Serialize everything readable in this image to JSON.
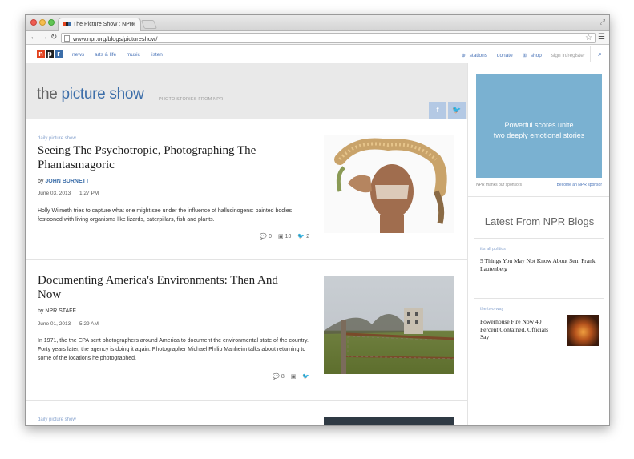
{
  "browser": {
    "tab_title": "The Picture Show : NPR",
    "url": "www.npr.org/blogs/pictureshow/"
  },
  "npr_nav": {
    "logo_letters": [
      "n",
      "p",
      "r"
    ],
    "logo_colors": [
      "#e2421e",
      "#222222",
      "#3c6ea9"
    ],
    "links": [
      "news",
      "arts & life",
      "music",
      "listen"
    ],
    "stations": "stations",
    "donate": "donate",
    "shop": "shop",
    "sign_in": "sign in/register"
  },
  "hero": {
    "title_prefix": "the",
    "title_main": "picture show",
    "subtitle": "PHOTO STORIES FROM NPR",
    "facebook": "f",
    "twitter": "t"
  },
  "stories": [
    {
      "kicker": "daily picture show",
      "headline": "Seeing The Psychotropic, Photographing The Phantasmagoric",
      "by": "by",
      "author": "JOHN BURNETT",
      "date": "June 03, 2013",
      "time": "1:27 PM",
      "teaser": "Holly Wilmeth tries to capture what one might see under the influence of hallucinogens: painted bodies festooned with living organisms like lizards, caterpillars, fish and plants.",
      "comments": "0",
      "facebook_count": "10",
      "twitter_count": "2"
    },
    {
      "kicker": "",
      "headline": "Documenting America's Environments: Then And Now",
      "by": "by",
      "author": "NPR STAFF",
      "date": "June 01, 2013",
      "time": "5:29 AM",
      "teaser": "In 1971, the the EPA sent photographers around America to document the environmental state of the country. Forty years later, the agency is doing it again. Photographer Michael Philip Manheim talks about returning to some of the locations he photographed.",
      "comments": "8",
      "facebook_count": "",
      "twitter_count": ""
    },
    {
      "kicker": "daily picture show"
    }
  ],
  "sidebar": {
    "ad_text_1": "Powerful scores unite",
    "ad_text_2": "two deeply emotional stories",
    "ad_note_left": "NPR thanks our sponsors",
    "ad_note_right": "Become an NPR sponsor",
    "latest_heading": "Latest From NPR Blogs",
    "posts": [
      {
        "kicker": "it's all politics",
        "headline": "5 Things You May Not Know About Sen. Frank Lautenberg"
      },
      {
        "kicker": "the two-way",
        "headline": "Powerhouse Fire Now 40 Percent Contained, Officials Say"
      }
    ]
  }
}
